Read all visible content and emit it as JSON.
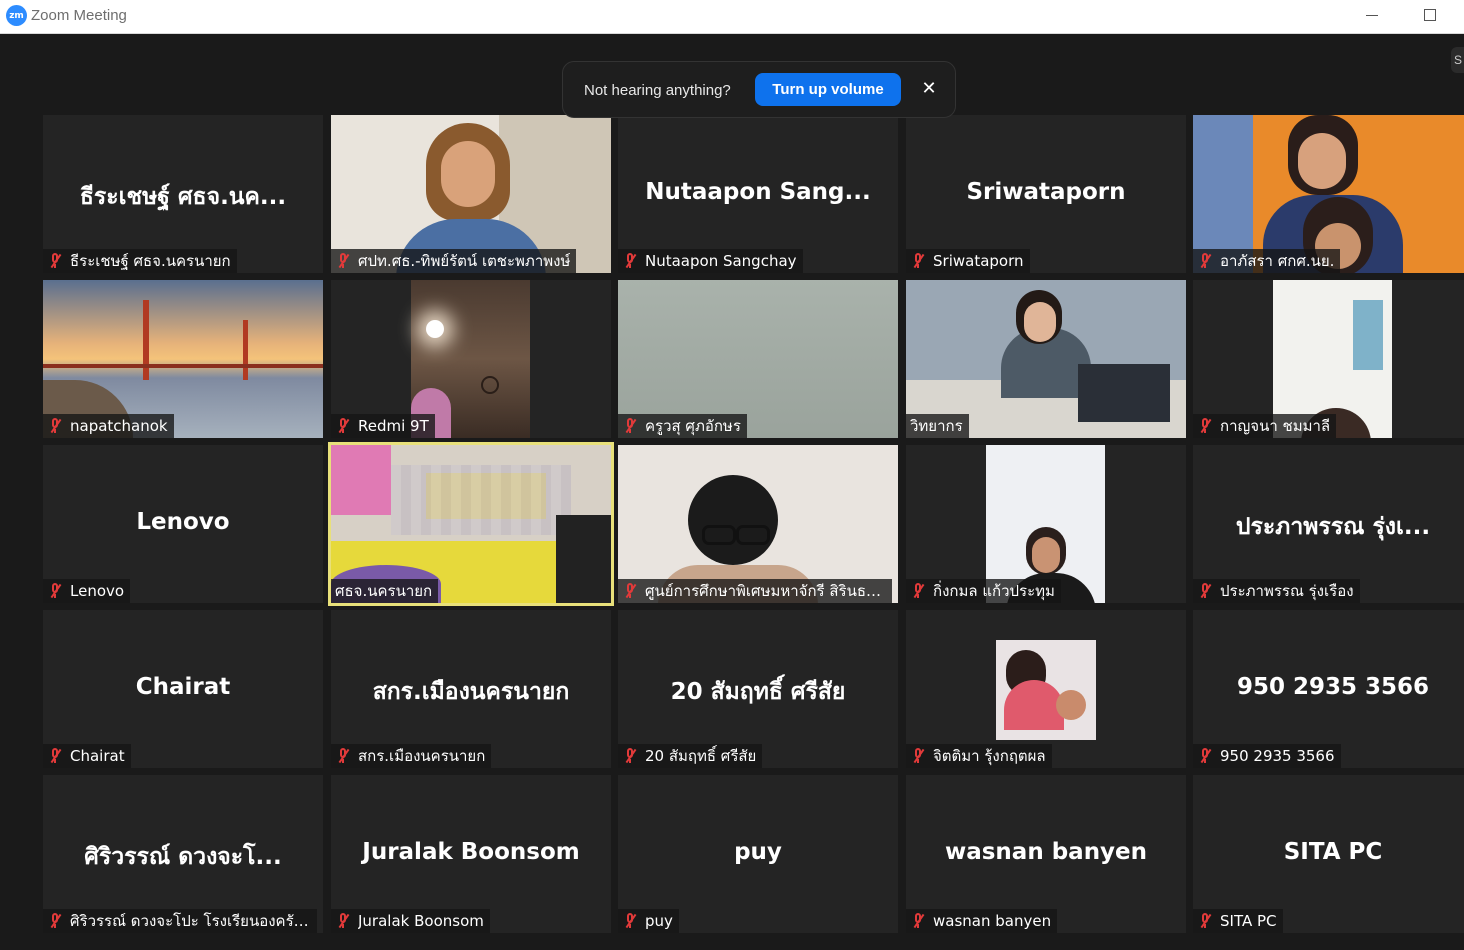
{
  "window": {
    "app_logo": "zm",
    "title": "Zoom Meeting"
  },
  "side_tab": {
    "label": "S"
  },
  "banner": {
    "text": "Not hearing anything?",
    "button": "Turn up volume",
    "close": "✕"
  },
  "tiles": [
    {
      "display_name": "ธีระเชษฐ์ ศธจ.นค...",
      "label": "ธีระเชษฐ์ ศธจ.นครนายก",
      "muted": true
    },
    {
      "display_name": "",
      "label": "ศปท.ศธ.-ทิพย์รัตน์ เตชะพภาพงษ์",
      "muted": true,
      "video": "woman-portrait-video"
    },
    {
      "display_name": "Nutaapon Sang...",
      "label": "Nutaapon Sangchay",
      "muted": true
    },
    {
      "display_name": "Sriwataporn",
      "label": "Sriwataporn",
      "muted": true
    },
    {
      "display_name": "",
      "label": "อาภัสรา ศกศ.นย.",
      "muted": true,
      "video": "two-women-video"
    },
    {
      "display_name": "",
      "label": "napatchanok",
      "muted": true,
      "video": "golden-gate-bridge-background"
    },
    {
      "display_name": "",
      "label": "Redmi 9T",
      "muted": true,
      "video": "ceiling-video"
    },
    {
      "display_name": "",
      "label": "ครูวสุ ศุภอักษร",
      "muted": true,
      "video": "wall-video"
    },
    {
      "display_name": "",
      "label": "วิทยากร",
      "muted": false,
      "video": "speaker-at-desk-video"
    },
    {
      "display_name": "",
      "label": "กาญจนา ชมมาลี",
      "muted": true,
      "video": "man-portrait-video"
    },
    {
      "display_name": "Lenovo",
      "label": "Lenovo",
      "muted": true
    },
    {
      "display_name": "",
      "label": "ศธจ.นครนายก",
      "muted": false,
      "active": true,
      "video": "meeting-room-video"
    },
    {
      "display_name": "",
      "label": "ศูนย์การศึกษาพิเศษมหาจักรี สิรินธรประ...",
      "muted": true,
      "video": "woman-glasses-video"
    },
    {
      "display_name": "",
      "label": "กิ่งกมล แก้วประทุม",
      "muted": true,
      "video": "woman-portrait-video-2"
    },
    {
      "display_name": "ประภาพรรณ รุ่งเ...",
      "label": "ประภาพรรณ รุ่งเรือง",
      "muted": true
    },
    {
      "display_name": "Chairat",
      "label": "Chairat",
      "muted": true
    },
    {
      "display_name": "สกร.เมืองนครนายก",
      "label": "สกร.เมืองนครนายก",
      "muted": true
    },
    {
      "display_name": "20 สัมฤทธิ์ ศรีสัย",
      "label": "20 สัมฤทธิ์ ศรีสัย",
      "muted": true
    },
    {
      "display_name": "",
      "label": "จิตติมา รุ้งกฤตผล",
      "muted": true,
      "video": "profile-photo-child"
    },
    {
      "display_name": "950 2935 3566",
      "label": "950 2935 3566",
      "muted": true
    },
    {
      "display_name": "ศิริวรรณ์ ดวงจะโ...",
      "label": "ศิริวรรณ์ ดวงจะโปะ โรงเรียนองครักษ์",
      "muted": true
    },
    {
      "display_name": "Juralak Boonsom",
      "label": "Juralak Boonsom",
      "muted": true
    },
    {
      "display_name": "puy",
      "label": "puy",
      "muted": true
    },
    {
      "display_name": "wasnan banyen",
      "label": "wasnan banyen",
      "muted": true
    },
    {
      "display_name": "SITA PC",
      "label": "SITA PC",
      "muted": true
    }
  ],
  "colors": {
    "background": "#1a1a1a",
    "tile": "#242424",
    "accent": "#0e72ed",
    "muted_icon": "#e23a3a",
    "active_speaker": "#e8e07a"
  }
}
